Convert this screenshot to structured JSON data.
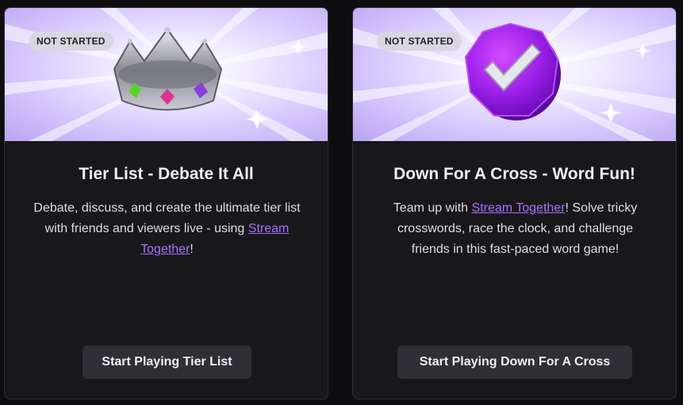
{
  "cards": [
    {
      "badge": "NOT STARTED",
      "art_icon": "crown-icon",
      "title": "Tier List - Debate It All",
      "description_before": "Debate, discuss, and create the ultimate tier list with friends and viewers live - using ",
      "link_text": "Stream Together",
      "description_after": "!",
      "button_label": "Start Playing Tier List"
    },
    {
      "badge": "NOT STARTED",
      "art_icon": "checkmark-coin-icon",
      "title": "Down For A Cross - Word Fun!",
      "description_before": "Team up with ",
      "link_text": "Stream Together",
      "description_after": "! Solve tricky crosswords, race the clock, and challenge friends in this fast-paced word game!",
      "button_label": "Start Playing Down For A Cross"
    }
  ],
  "colors": {
    "background": "#0e0e10",
    "card": "#18181b",
    "accent_link": "#a970ff",
    "button": "#2f2f35",
    "badge": "#d9d6e2"
  }
}
